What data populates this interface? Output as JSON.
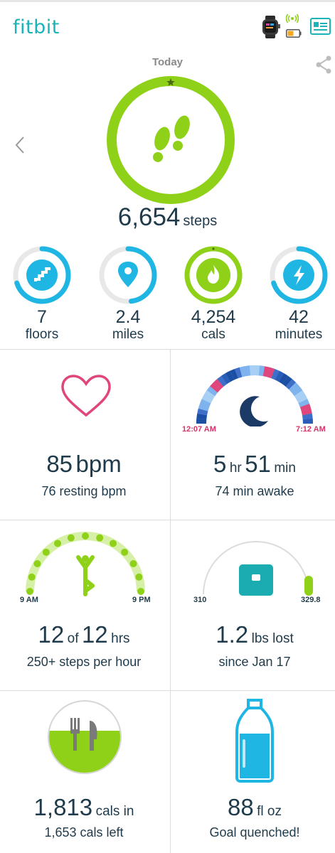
{
  "app": {
    "logo": "fitbit"
  },
  "header": {
    "device": "smartwatch",
    "icons": [
      "watch-icon",
      "sync-signal-icon",
      "battery-icon",
      "profile-card-icon"
    ]
  },
  "today": {
    "label": "Today",
    "steps_value": "6,654",
    "steps_unit": "steps"
  },
  "stats": [
    {
      "value": "7",
      "label": "floors",
      "icon": "stairs-icon",
      "progress": 0.7,
      "color": "#20b6e4"
    },
    {
      "value": "2.4",
      "label": "miles",
      "icon": "location-pin-icon",
      "progress": 0.48,
      "color": "#20b6e4"
    },
    {
      "value": "4,254",
      "label": "cals",
      "icon": "flame-icon",
      "progress": 1.0,
      "color": "#8fd118"
    },
    {
      "value": "42",
      "label": "minutes",
      "icon": "lightning-icon",
      "progress": 0.7,
      "color": "#20b6e4"
    }
  ],
  "heart": {
    "value": "85",
    "unit": "bpm",
    "sub": "76 resting bpm"
  },
  "sleep": {
    "start": "12:07 AM",
    "end": "7:12 AM",
    "hours": "5",
    "hours_unit": "hr",
    "minutes": "51",
    "minutes_unit": "min",
    "sub": "74 min awake"
  },
  "hourly": {
    "start": "9 AM",
    "end": "9 PM",
    "achieved": "12",
    "of": "of",
    "total": "12",
    "unit": "hrs",
    "sub": "250+ steps per hour"
  },
  "weight": {
    "min": "310",
    "max": "329.8",
    "value": "1.2",
    "unit": "lbs lost",
    "sub": "since Jan 17"
  },
  "food": {
    "value": "1,813",
    "unit": "cals in",
    "sub": "1,653 cals left"
  },
  "water": {
    "value": "88",
    "unit": "fl oz",
    "sub": "Goal quenched!"
  },
  "colors": {
    "brand": "#19b3b8",
    "green": "#8fd118",
    "blue": "#20b6e4",
    "text": "#1f3a4a",
    "heart": "#e0457b",
    "sleep_dark": "#1b3a66",
    "scale": "#1aacb0"
  }
}
